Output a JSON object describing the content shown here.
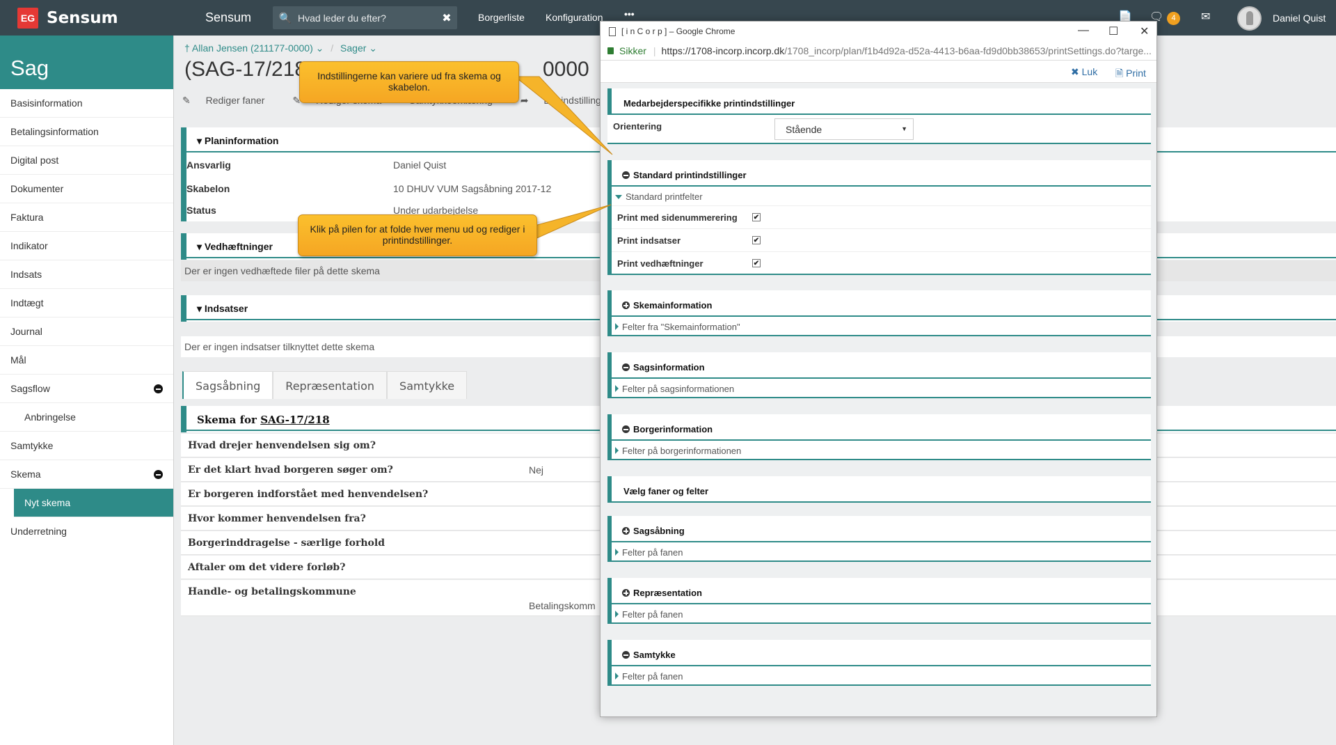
{
  "topbar": {
    "logo_mark": "EG",
    "logo_text": "Sensum",
    "app_name": "Sensum",
    "search_placeholder": "Hvad leder du efter?",
    "nav": [
      "Borgerliste",
      "Konfiguration",
      "•••"
    ],
    "notification_count": "4",
    "user_name": "Daniel Quist"
  },
  "sidebar": {
    "title": "Sag",
    "items": [
      {
        "label": "Basisinformation"
      },
      {
        "label": "Betalingsinformation"
      },
      {
        "label": "Digital post"
      },
      {
        "label": "Dokumenter"
      },
      {
        "label": "Faktura"
      },
      {
        "label": "Indikator"
      },
      {
        "label": "Indsats"
      },
      {
        "label": "Indtægt"
      },
      {
        "label": "Journal"
      },
      {
        "label": "Mål"
      },
      {
        "label": "Sagsflow"
      },
      {
        "label": "Anbringelse"
      },
      {
        "label": "Samtykke"
      },
      {
        "label": "Skema"
      },
      {
        "label": "Nyt skema"
      },
      {
        "label": "Underretning"
      }
    ]
  },
  "main": {
    "breadcrumb_person": "Allan Jensen (211177-0000)",
    "breadcrumb_cases": "Sager",
    "title": "(SAG-17/218",
    "title_tail": "0000",
    "toolbar": [
      "Rediger faner",
      "Rediger skema",
      "Samtykkeerklæring",
      "Del indstilling"
    ],
    "plan_header": "Planinformation",
    "plan_rows": [
      {
        "label": "Ansvarlig",
        "value": "Daniel Quist"
      },
      {
        "label": "Skabelon",
        "value": "10 DHUV VUM Sagsåbning 2017-12"
      },
      {
        "label": "Status",
        "value": "Under udarbejdelse"
      }
    ],
    "attach_header": "Vedhæftninger",
    "attach_empty": "Der er ingen vedhæftede filer på dette skema",
    "efforts_header": "Indsatser",
    "efforts_empty": "Der er ingen indsatser tilknyttet dette skema",
    "tabs": [
      "Sagsåbning",
      "Repræsentation",
      "Samtykke"
    ],
    "schema_title": "Skema for",
    "schema_ref": "SAG-17/218",
    "questions": [
      {
        "q": "Hvad drejer henvendelsen sig om?",
        "a": ""
      },
      {
        "q": "Er det klart hvad borgeren søger om?",
        "a": "Nej"
      },
      {
        "q": "Er borgeren indforstået med henvendelsen?",
        "a": ""
      },
      {
        "q": "Hvor kommer henvendelsen fra?",
        "a": ""
      },
      {
        "q": "Borgerinddragelse - særlige forhold",
        "a": ""
      },
      {
        "q": "Aftaler om det videre forløb?",
        "a": ""
      },
      {
        "q": "Handle- og betalingskommune",
        "a": "Betalingskomm"
      }
    ]
  },
  "popup": {
    "window_title": "[ i n C o r p ] – Google Chrome",
    "secure_label": "Sikker",
    "url_host": "https://1708-incorp.incorp.dk",
    "url_rest": "/1708_incorp/plan/f1b4d92a-d52a-4413-b6aa-fd9d0bb38653/printSettings.do?targe...",
    "close_label": "Luk",
    "print_label": "Print",
    "employee_header": "Medarbejderspecifikke printindstillinger",
    "orientation_label": "Orientering",
    "orientation_value": "Stående",
    "standard_header": "Standard printindstillinger",
    "standard_sub": "Standard printfelter",
    "standard_rows": [
      "Print med sidenummerering",
      "Print indsatser",
      "Print vedhæftninger"
    ],
    "sections": [
      {
        "title": "Skemainformation",
        "sub": "Felter fra \"Skemainformation\"",
        "icon": "plus-circle-icon"
      },
      {
        "title": "Sagsinformation",
        "sub": "Felter på sagsinformationen",
        "icon": "minus-circle-icon"
      },
      {
        "title": "Borgerinformation",
        "sub": "Felter på borgerinformationen",
        "icon": "minus-circle-icon"
      }
    ],
    "select_header": "Vælg faner og felter",
    "tab_sections": [
      {
        "title": "Sagsåbning",
        "sub": "Felter på fanen",
        "icon": "plus-circle-icon"
      },
      {
        "title": "Repræsentation",
        "sub": "Felter på fanen",
        "icon": "plus-circle-icon"
      },
      {
        "title": "Samtykke",
        "sub": "Felter på fanen",
        "icon": "minus-circle-icon"
      }
    ]
  },
  "callouts": {
    "top": "Indstillingerne kan variere ud fra skema og skabelon.",
    "middle": "Klik på pilen for at folde hver menu ud og rediger i printindstillinger."
  },
  "colors": {
    "teal": "#2e8b88",
    "topbar": "#37474f",
    "callout": "#f5a623",
    "badge": "#f0a020"
  }
}
